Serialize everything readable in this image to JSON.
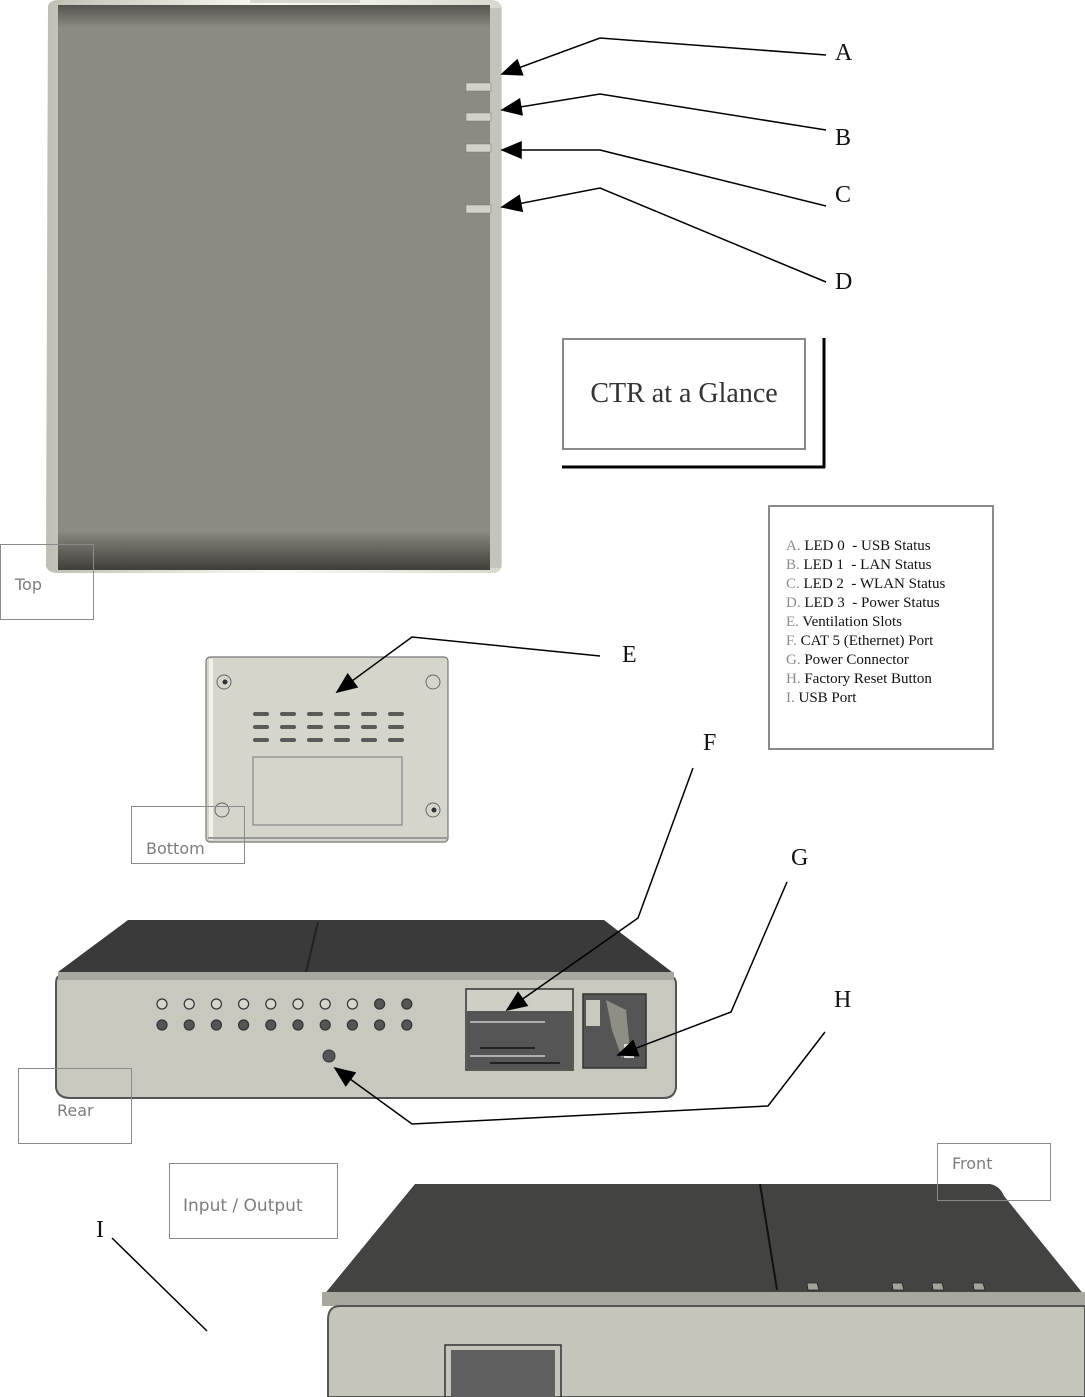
{
  "title": "CTR at a Glance",
  "legend": {
    "items": [
      {
        "key": "A.",
        "text": "LED 0  - USB Status"
      },
      {
        "key": "B.",
        "text": "LED 1  - LAN Status"
      },
      {
        "key": "C.",
        "text": "LED 2  - WLAN Status"
      },
      {
        "key": "D.",
        "text": "LED 3  - Power Status"
      },
      {
        "key": "E.",
        "text": "Ventilation Slots"
      },
      {
        "key": "F.",
        "text": "CAT 5 (Ethernet) Port"
      },
      {
        "key": "G.",
        "text": "Power Connector"
      },
      {
        "key": "H.",
        "text": "Factory Reset Button"
      },
      {
        "key": "I.",
        "text": "USB Port"
      }
    ]
  },
  "callouts": {
    "a": "A",
    "b": "B",
    "c": "C",
    "d": "D",
    "e": "E",
    "f": "F",
    "g": "G",
    "h": "H",
    "i": "I"
  },
  "views": {
    "top": "Top",
    "bottom": "Bottom",
    "rear": "Rear",
    "front": "Front",
    "io": "Input / Output"
  },
  "colors": {
    "top_panel": "#8c8a82",
    "device_dark": "#3d3e3c",
    "device_face": "#c9c8bf",
    "label_gray": "#7d7d7d",
    "box_border": "#8a8a8a"
  }
}
